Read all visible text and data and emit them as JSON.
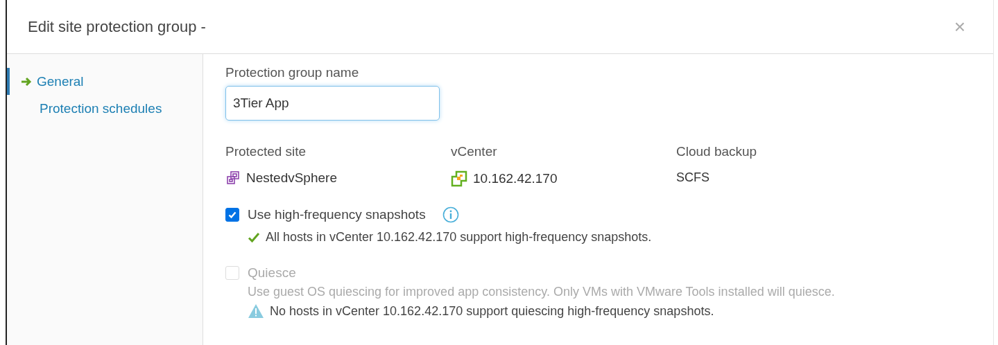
{
  "dialog": {
    "title": "Edit site protection group -",
    "close": "×"
  },
  "nav": [
    {
      "label": "General",
      "selected": true
    },
    {
      "label": "Protection schedules",
      "selected": false
    }
  ],
  "name_field": {
    "label": "Protection group name",
    "value": "3Tier App"
  },
  "details": [
    {
      "label": "Protected site",
      "value": "NestedvSphere",
      "kind": "site"
    },
    {
      "label": "vCenter",
      "value": "10.162.42.170",
      "kind": "vcenter"
    },
    {
      "label": "Cloud backup",
      "value": "SCFS",
      "kind": "plain"
    }
  ],
  "options": [
    {
      "label": "Use high-frequency snapshots",
      "checked": true,
      "disabled": false,
      "info": true,
      "status": {
        "kind": "ok",
        "text": "All hosts in vCenter 10.162.42.170 support high-frequency snapshots."
      }
    },
    {
      "label": "Quiesce",
      "checked": false,
      "disabled": true,
      "info": false,
      "description": "Use guest OS quiescing for improved app consistency. Only VMs with VMware Tools installed will quiesce.",
      "status": {
        "kind": "warning",
        "text": "No hosts in vCenter 10.162.42.170 support quiescing high-frequency snapshots."
      }
    }
  ]
}
